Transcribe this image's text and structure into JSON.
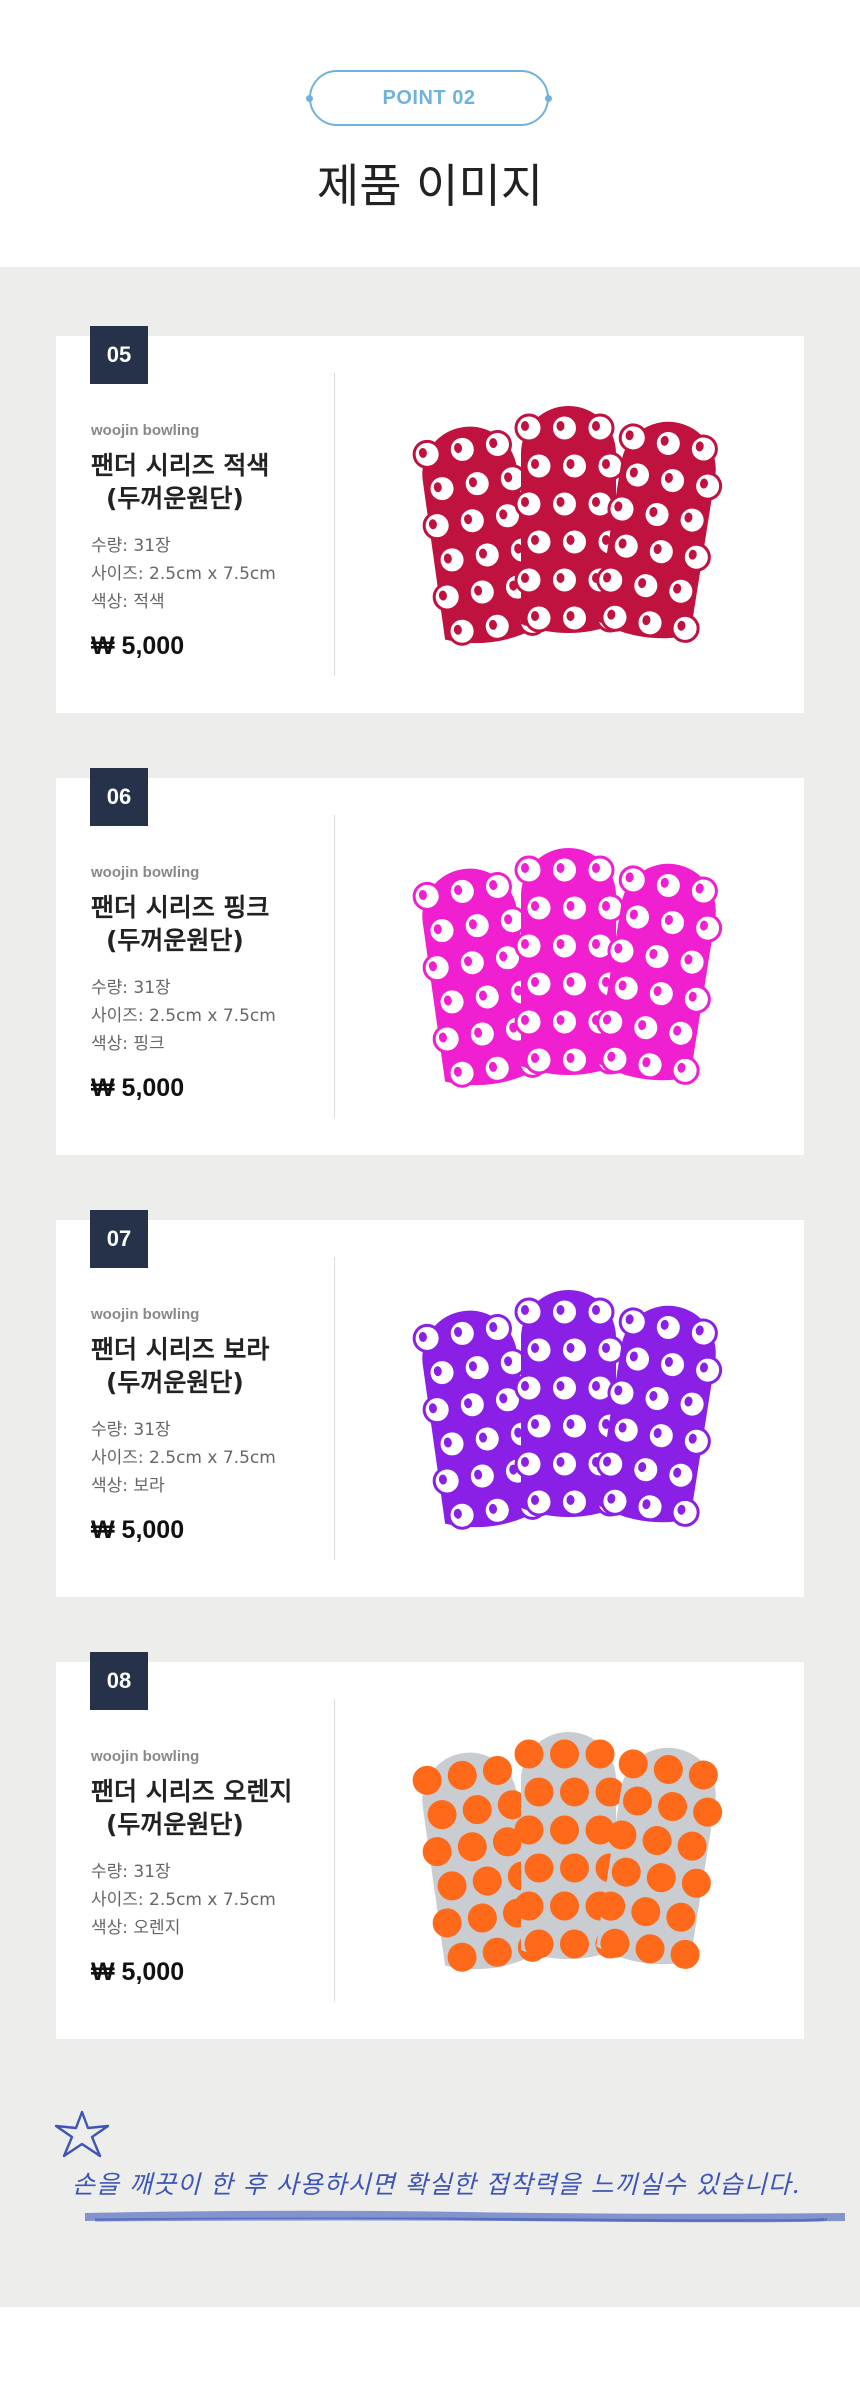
{
  "header": {
    "point_label": "POINT 02",
    "title": "제품 이미지"
  },
  "products": [
    {
      "number": "05",
      "brand": "woojin bowling",
      "name_line1": "팬더 시리즈 적색",
      "name_line2": "(두꺼운원단)",
      "qty": "수량: 31장",
      "size": "사이즈: 2.5cm x 7.5cm",
      "color": "색상: 적색",
      "price": "₩ 5,000",
      "swatch": "#c0123f",
      "bg": "#ffffff"
    },
    {
      "number": "06",
      "brand": "woojin bowling",
      "name_line1": "팬더 시리즈 핑크",
      "name_line2": "(두꺼운원단)",
      "qty": "수량: 31장",
      "size": "사이즈: 2.5cm x 7.5cm",
      "color": "색상: 핑크",
      "price": "₩ 5,000",
      "swatch": "#f01fd0",
      "bg": "#ffffff"
    },
    {
      "number": "07",
      "brand": "woojin bowling",
      "name_line1": "팬더 시리즈 보라",
      "name_line2": "(두꺼운원단)",
      "qty": "수량: 31장",
      "size": "사이즈: 2.5cm x 7.5cm",
      "color": "색상: 보라",
      "price": "₩ 5,000",
      "swatch": "#8a1fe6",
      "bg": "#ffffff"
    },
    {
      "number": "08",
      "brand": "woojin bowling",
      "name_line1": "팬더 시리즈 오렌지",
      "name_line2": "(두꺼운원단)",
      "qty": "수량: 31장",
      "size": "사이즈: 2.5cm x 7.5cm",
      "color": "색상: 오렌지",
      "price": "₩ 5,000",
      "swatch": "#ff6a1a",
      "bg": "#c9cdd1"
    }
  ],
  "note": {
    "text": "손을 깨끗이 한 후 사용하시면 확실한 접착력을 느끼실수 있습니다.",
    "color": "#3d55b8"
  }
}
